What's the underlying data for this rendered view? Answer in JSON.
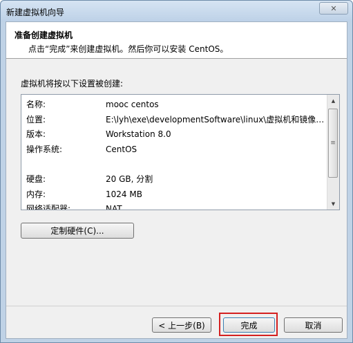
{
  "window": {
    "title": "新建虚拟机向导",
    "close_label": "✕"
  },
  "header": {
    "title": "准备创建虚拟机",
    "subtitle": "点击“完成”来创建虚拟机。然后你可以安装 CentOS。"
  },
  "intro": "虚拟机将按以下设置被创建:",
  "settings": [
    {
      "key": "名称:",
      "value": "mooc centos"
    },
    {
      "key": "位置:",
      "value": "E:\\lyh\\exe\\developmentSoftware\\linux\\虚拟机和镜像\\..."
    },
    {
      "key": "版本:",
      "value": "Workstation 8.0"
    },
    {
      "key": "操作系统:",
      "value": "CentOS"
    },
    {
      "key": "",
      "value": ""
    },
    {
      "key": "硬盘:",
      "value": "20 GB, 分割"
    },
    {
      "key": "内存:",
      "value": "1024 MB"
    },
    {
      "key": "网络适配器:",
      "value": "NAT"
    }
  ],
  "buttons": {
    "customize_hardware": "定制硬件(C)...",
    "back": "< 上一步(B)",
    "finish": "完成",
    "cancel": "取消"
  },
  "icons": {
    "scroll_up": "▲",
    "scroll_down": "▼",
    "scroll_grip": "≡"
  },
  "colors": {
    "highlight": "#d42020",
    "title_bar": "#bdd1e7"
  }
}
